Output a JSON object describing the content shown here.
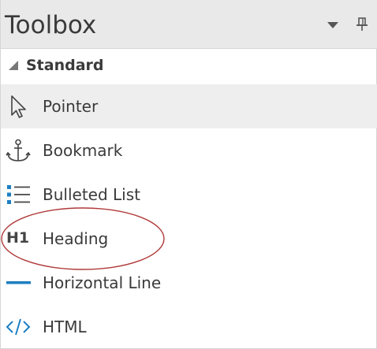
{
  "panel": {
    "title": "Toolbox",
    "dropdown_icon": "chevron-down-icon",
    "pin_icon": "pin-icon"
  },
  "section": {
    "label": "Standard",
    "expanded": true
  },
  "items": [
    {
      "label": "Pointer",
      "icon": "pointer-icon",
      "selected": true
    },
    {
      "label": "Bookmark",
      "icon": "anchor-icon",
      "selected": false
    },
    {
      "label": "Bulleted List",
      "icon": "bulleted-list-icon",
      "selected": false
    },
    {
      "label": "Heading",
      "icon": "heading-icon",
      "icon_text": "H1",
      "selected": false
    },
    {
      "label": "Horizontal Line",
      "icon": "horizontal-line-icon",
      "selected": false
    },
    {
      "label": "HTML",
      "icon": "html-code-icon",
      "selected": false
    }
  ],
  "colors": {
    "accent_blue": "#1e7fc2",
    "annotation_red": "#b03a3a",
    "selected_row": "#eeeeee",
    "titlebar": "#e9e9e9"
  }
}
